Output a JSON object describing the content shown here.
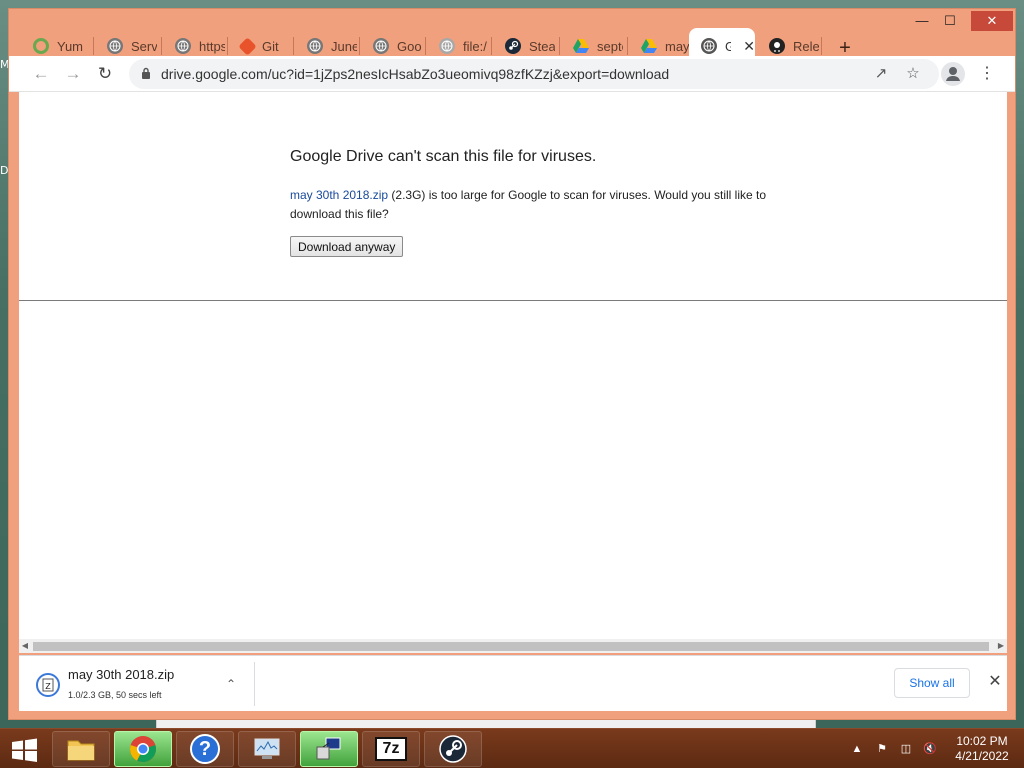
{
  "browser": {
    "tabs": [
      {
        "label": "Yum",
        "icon": "green-ring-icon",
        "color": "#6aa84f"
      },
      {
        "label": "Serve",
        "icon": "globe-icon",
        "color": "#666666"
      },
      {
        "label": "https",
        "icon": "globe-icon",
        "color": "#666666"
      },
      {
        "label": "Git",
        "icon": "git-icon",
        "color": "#e8532b"
      },
      {
        "label": "June",
        "icon": "globe-icon",
        "color": "#666666"
      },
      {
        "label": "Goo",
        "icon": "globe-icon",
        "color": "#666666"
      },
      {
        "label": "file:/",
        "icon": "globe-icon",
        "color": "#9a9a9a"
      },
      {
        "label": "Stea",
        "icon": "steam-icon",
        "color": "#1b2838"
      },
      {
        "label": "septe",
        "icon": "google-drive-icon",
        "color": "#1fa463"
      },
      {
        "label": "may",
        "icon": "google-drive-icon",
        "color": "#1fa463"
      },
      {
        "label": "G",
        "icon": "globe-icon",
        "color": "#555555",
        "active": true
      },
      {
        "label": "Rele",
        "icon": "github-icon",
        "color": "#222222"
      }
    ],
    "url": "drive.google.com/uc?id=1jZps2nesIcHsabZo3ueomivq98zfKZzj&export=download",
    "accent_color": "#f0a07d"
  },
  "page": {
    "title": "Google Drive can't scan this file for viruses.",
    "file_link": "may 30th 2018.zip",
    "file_size": "(2.3G)",
    "body_rest": " is too large for Google to scan for viruses. Would you still like to download this file?",
    "download_button": "Download anyway"
  },
  "download_shelf": {
    "file_name": "may 30th 2018.zip",
    "status": "1.0/2.3 GB, 50 secs left",
    "show_all_label": "Show all"
  },
  "desktop": {
    "edge_labels": [
      "M",
      "D"
    ]
  },
  "taskbar": {
    "apps": [
      {
        "name": "file-explorer",
        "icon": "folder-icon"
      },
      {
        "name": "chrome",
        "icon": "chrome-icon",
        "active": true
      },
      {
        "name": "help",
        "icon": "help-icon",
        "glyph": "?"
      },
      {
        "name": "system-monitor",
        "icon": "monitor-icon"
      },
      {
        "name": "network-tool",
        "icon": "network-icon",
        "active": true
      },
      {
        "name": "7zip",
        "icon": "7zip-icon",
        "glyph": "7z"
      },
      {
        "name": "steam",
        "icon": "steam-icon"
      }
    ],
    "clock_time": "10:02 PM",
    "clock_date": "4/21/2022"
  }
}
